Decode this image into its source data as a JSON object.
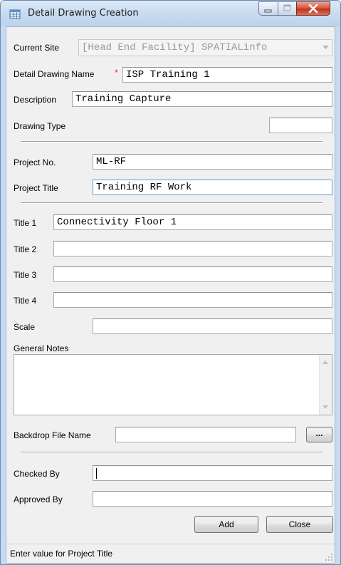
{
  "window": {
    "title": "Detail Drawing Creation",
    "icon": "grid-document-icon"
  },
  "form": {
    "current_site": {
      "label": "Current Site",
      "value": "[Head End Facility] SPATIALinfo"
    },
    "detail_drawing_name": {
      "label": "Detail Drawing Name",
      "required_marker": "*",
      "value": "ISP Training 1"
    },
    "description": {
      "label": "Description",
      "value": "Training Capture"
    },
    "drawing_type": {
      "label": "Drawing Type",
      "value": ""
    },
    "project_no": {
      "label": "Project No.",
      "value": "ML-RF"
    },
    "project_title": {
      "label": "Project Title",
      "value": "Training RF Work"
    },
    "title1": {
      "label": "Title 1",
      "value": "Connectivity Floor 1"
    },
    "title2": {
      "label": "Title 2",
      "value": ""
    },
    "title3": {
      "label": "Title 3",
      "value": ""
    },
    "title4": {
      "label": "Title 4",
      "value": ""
    },
    "scale": {
      "label": "Scale",
      "value": ""
    },
    "general_notes": {
      "label": "General Notes",
      "value": ""
    },
    "backdrop_file_name": {
      "label": "Backdrop File Name",
      "value": "",
      "browse_label": "..."
    },
    "checked_by": {
      "label": "Checked By",
      "value": ""
    },
    "approved_by": {
      "label": "Approved By",
      "value": ""
    }
  },
  "buttons": {
    "add": "Add",
    "close": "Close"
  },
  "status": {
    "text": "Enter value for Project Title"
  },
  "colors": {
    "title_bar": "#c9dbf0",
    "client_bg": "#f0f0f0",
    "focus_border": "#5f9bd8",
    "required_marker": "#e22222",
    "close_button": "#c3341d"
  }
}
